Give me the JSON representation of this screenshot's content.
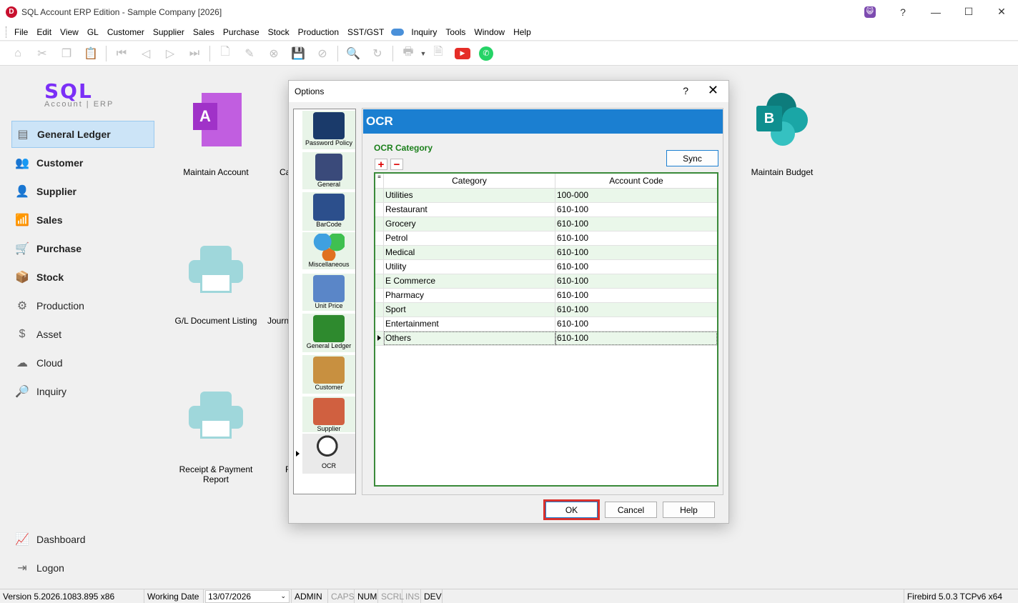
{
  "window": {
    "title": "SQL Account ERP Edition - Sample Company [2026]",
    "logo_letter": "D",
    "help_glyph": "?",
    "minimize_glyph": "—",
    "maximize_glyph": "☐",
    "close_glyph": "✕"
  },
  "menu": {
    "items": [
      "File",
      "Edit",
      "View",
      "GL",
      "Customer",
      "Supplier",
      "Sales",
      "Purchase",
      "Stock",
      "Production",
      "SST/GST",
      "Inquiry",
      "Tools",
      "Window",
      "Help"
    ]
  },
  "toolbar": {
    "icons": [
      "home-icon",
      "cut-icon",
      "copy-icon",
      "paste-icon",
      "first-icon",
      "prior-icon",
      "next-icon",
      "last-icon",
      "new-icon",
      "edit-icon",
      "delete-icon",
      "save-icon",
      "cancel-icon",
      "find-icon",
      "refresh-icon",
      "print-icon",
      "preview-icon",
      "youtube-icon",
      "whatsapp-icon"
    ]
  },
  "brand": {
    "name": "SQL",
    "subtitle": "Account | ERP"
  },
  "sidebar": {
    "items": [
      {
        "label": "General Ledger",
        "icon": "ledger-icon"
      },
      {
        "label": "Customer",
        "icon": "customer-icon"
      },
      {
        "label": "Supplier",
        "icon": "supplier-icon"
      },
      {
        "label": "Sales",
        "icon": "sales-icon"
      },
      {
        "label": "Purchase",
        "icon": "purchase-icon"
      },
      {
        "label": "Stock",
        "icon": "stock-icon"
      },
      {
        "label": "Production",
        "icon": "production-icon"
      },
      {
        "label": "Asset",
        "icon": "asset-icon"
      },
      {
        "label": "Cloud",
        "icon": "cloud-icon"
      },
      {
        "label": "Inquiry",
        "icon": "inquiry-icon"
      }
    ],
    "bottom_items": [
      {
        "label": "Dashboard",
        "icon": "dashboard-icon"
      },
      {
        "label": "Logon",
        "icon": "logon-icon"
      }
    ]
  },
  "main": {
    "tiles": {
      "maintain_account": "Maintain Account",
      "ca_partial": "Ca",
      "gl_document_listing": "G/L Document Listing",
      "journ_partial": "Journ",
      "receipt_payment_report": "Receipt & Payment Report",
      "r_partial": "F",
      "maintain_budget": "Maintain Budget",
      "maintain_account_letter": "A",
      "maintain_budget_letter": "B"
    }
  },
  "dialog": {
    "title": "Options",
    "help_glyph": "?",
    "close_glyph": "✕",
    "categories": [
      {
        "label": "Password Policy",
        "icon": "password-policy-icon"
      },
      {
        "label": "General",
        "icon": "general-icon"
      },
      {
        "label": "BarCode",
        "icon": "barcode-icon"
      },
      {
        "label": "Miscellaneous",
        "icon": "miscellaneous-icon"
      },
      {
        "label": "Unit Price",
        "icon": "unit-price-icon"
      },
      {
        "label": "General Ledger",
        "icon": "general-ledger-icon"
      },
      {
        "label": "Customer",
        "icon": "customer-icon"
      },
      {
        "label": "Supplier",
        "icon": "supplier-icon"
      },
      {
        "label": "OCR",
        "icon": "ocr-icon"
      }
    ],
    "panel": {
      "header": "OCR",
      "section_title": "OCR Category",
      "sync_label": "Sync",
      "add_glyph": "+",
      "remove_glyph": "−",
      "grid": {
        "indicator_glyph": "≡",
        "columns": [
          "Category",
          "Account Code"
        ],
        "rows": [
          {
            "category": "Utilities",
            "account_code": "100-000"
          },
          {
            "category": "Restaurant",
            "account_code": "610-100"
          },
          {
            "category": "Grocery",
            "account_code": "610-100"
          },
          {
            "category": "Petrol",
            "account_code": "610-100"
          },
          {
            "category": "Medical",
            "account_code": "610-100"
          },
          {
            "category": "Utility",
            "account_code": "610-100"
          },
          {
            "category": "E Commerce",
            "account_code": "610-100"
          },
          {
            "category": "Pharmacy",
            "account_code": "610-100"
          },
          {
            "category": "Sport",
            "account_code": "610-100"
          },
          {
            "category": "Entertainment",
            "account_code": "610-100"
          },
          {
            "category": "Others",
            "account_code": "610-100"
          }
        ]
      }
    },
    "buttons": {
      "ok": "OK",
      "cancel": "Cancel",
      "help": "Help"
    }
  },
  "statusbar": {
    "version": "Version 5.2026.1083.895 x86",
    "working_date_label": "Working Date",
    "working_date": "13/07/2026",
    "admin": "ADMIN",
    "caps": "CAPS",
    "num": "NUM",
    "scrl": "SCRL",
    "ins": "INS",
    "dev": "DEV",
    "db": "Firebird 5.0.3 TCPv6 x64"
  },
  "colors": {
    "accent": "#1b7fd1",
    "brand_purple": "#7b2ff7",
    "grid_border": "#3a8a3a",
    "highlight": "#d9302c"
  }
}
